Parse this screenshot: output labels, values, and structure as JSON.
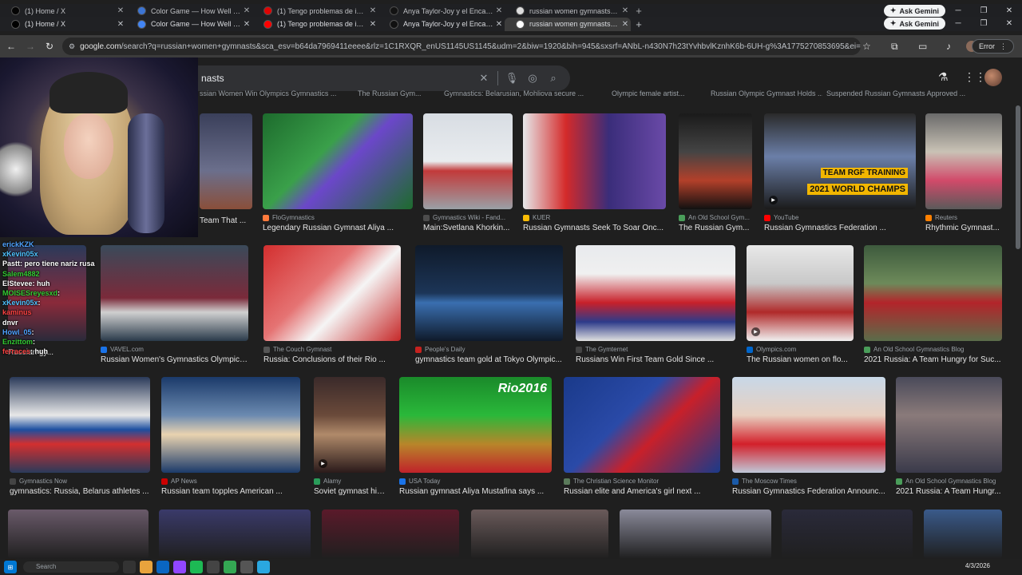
{
  "tabs_ghost": [
    {
      "label": "(1) Home / X",
      "fav": "x-logo"
    },
    {
      "label": "Color Game — How Well Can Y...",
      "fav": "chrome-logo"
    },
    {
      "label": "(1) Tengo problemas de identid...",
      "fav": "youtube-logo"
    },
    {
      "label": "Anya Taylor-Joy y el Encanto de...",
      "fav": "tiktok-logo"
    },
    {
      "label": "russian women gymnasts - Goo...",
      "fav": "google-logo"
    }
  ],
  "tabs": [
    {
      "label": "(1) Home / X",
      "fav": "x-logo"
    },
    {
      "label": "Color Game — How Well Can Y...",
      "fav": "chrome-logo"
    },
    {
      "label": "(1) Tengo problemas de identid...",
      "fav": "youtube-logo"
    },
    {
      "label": "Anya Taylor-Joy y el Encanto de...",
      "fav": "tiktok-logo"
    },
    {
      "label": "russian women gymnasts - Goo...",
      "fav": "google-logo",
      "active": true
    }
  ],
  "gemini_label": "Ask Gemini",
  "url": {
    "host": "google.com",
    "rest": "/search?q=russian+women+gymnasts&sca_esv=b64da7969411eeee&rlz=1C1RXQR_enUS1145US1145&udm=2&biw=1920&bih=945&sxsrf=ANbL-n430N7h23tYvhbvlKznhK6b-6UH-g%3A1775270853695&ei=xXvQab-CKt..."
  },
  "error_label": "Error",
  "search": {
    "query": "nasts"
  },
  "cutoff_row": [
    "ssian Women Win Olympics Gymnastics ...",
    "The Russian Gym...",
    "Gymnastics: Belarusian, Mohliova secure ...",
    "Olympic female artist...",
    "Russian Olympic Gymnast Holds ...",
    "Suspended Russian Gymnasts Approved ..."
  ],
  "row1": [
    {
      "src": "",
      "title": "Team That ..."
    },
    {
      "src": "FloGymnastics",
      "title": "Legendary Russian Gymnast Aliya ..."
    },
    {
      "src": "Gymnastics Wiki - Fand...",
      "title": "Main:Svetlana Khorkin..."
    },
    {
      "src": "KUER",
      "title": "Russian Gymnasts Seek To Soar Onc..."
    },
    {
      "src": "An Old School Gym...",
      "title": "The Russian Gym..."
    },
    {
      "src": "YouTube",
      "title": "Russian Gymnastics Federation ...",
      "overlay1": "TEAM RGF TRAINING",
      "overlay2": "2021 WORLD CHAMPS"
    },
    {
      "src": "Reuters",
      "title": "Rhythmic Gymnast..."
    }
  ],
  "row2": [
    {
      "src": "",
      "title": "Russian gy..."
    },
    {
      "src": "VAVEL.com",
      "title": "Russian Women's Gymnastics Olympic T..."
    },
    {
      "src": "The Couch Gymnast",
      "title": "Russia: Conclusions of their Rio ..."
    },
    {
      "src": "People's Daily",
      "title": "gymnastics team gold at Tokyo Olympic..."
    },
    {
      "src": "The Gymternet",
      "title": "Russians Win First Team Gold Since ..."
    },
    {
      "src": "Olympics.com",
      "title": "The Russian women on flo..."
    },
    {
      "src": "An Old School Gymnastics Blog",
      "title": "2021 Russia: A Team Hungry for Suc..."
    }
  ],
  "row3": [
    {
      "src": "Gymnastics Now",
      "title": "gymnastics: Russia, Belarus athletes ..."
    },
    {
      "src": "AP News",
      "title": "Russian team topples American ..."
    },
    {
      "src": "Alamy",
      "title": "Soviet gymnast hi-..."
    },
    {
      "src": "USA Today",
      "title": "Russian gymnast Aliya Mustafina says ...",
      "overlay1": "Rio2016"
    },
    {
      "src": "The Christian Science Monitor",
      "title": "Russian elite and America's girl next ..."
    },
    {
      "src": "The Moscow Times",
      "title": "Russian Gymnastics Federation Announc..."
    },
    {
      "src": "An Old School Gymnastics Blog",
      "title": "2021 Russia: A Team Hungr..."
    }
  ],
  "chat": [
    {
      "user": "erickKZK",
      "msg": "",
      "color": "#4fa3ff"
    },
    {
      "user": "xKevin05x",
      "msg": "",
      "color": "#4fc3ff"
    },
    {
      "user": "Pastt",
      "msg": ": pero tiene nariz rusa",
      "color": "#ffffff"
    },
    {
      "user": "Salem4882",
      "msg": "",
      "color": "#33cc33"
    },
    {
      "user": "ElStevee",
      "msg": ": huh",
      "color": "#ffffff"
    },
    {
      "user": "MOISESreyesxd",
      "msg": ":",
      "color": "#33cc33"
    },
    {
      "user": "xKevin05x",
      "msg": ":",
      "color": "#4fc3ff"
    },
    {
      "user": "kaminus",
      "msg": "",
      "color": "#ff4444"
    },
    {
      "user": "dnvr",
      "msg": "",
      "color": "#ffffff"
    },
    {
      "user": "Howl_05",
      "msg": ":",
      "color": "#4fa3ff"
    },
    {
      "user": "Enzittom",
      "msg": ":",
      "color": "#33cc33"
    },
    {
      "user": "ferraces",
      "msg": ": huh",
      "color": "#ff4444"
    }
  ],
  "taskbar": {
    "search": "Search",
    "date": "4/3/2026"
  }
}
